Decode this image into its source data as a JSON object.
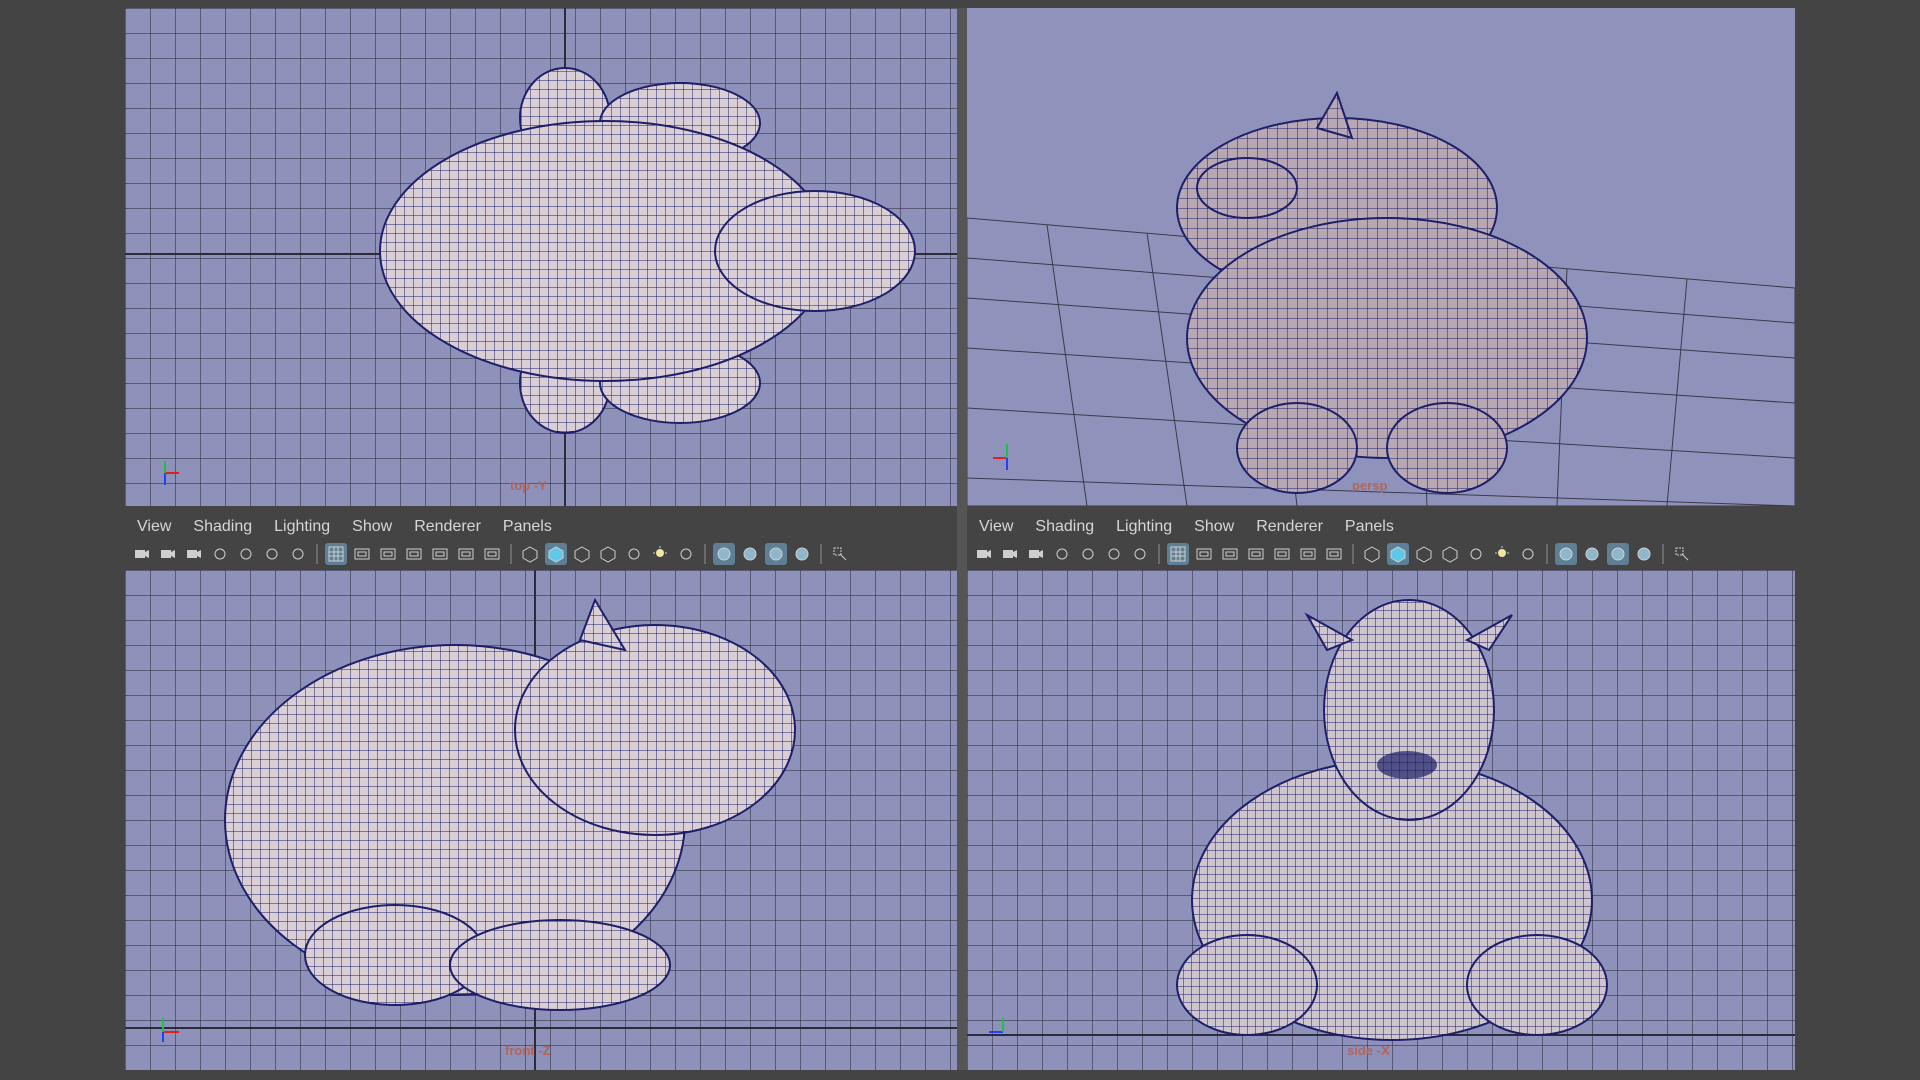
{
  "menus": [
    "View",
    "Shading",
    "Lighting",
    "Show",
    "Renderer",
    "Panels"
  ],
  "viewports": {
    "top": {
      "label": "top -Y"
    },
    "persp": {
      "label": "persp"
    },
    "front": {
      "label": "front -Z"
    },
    "side": {
      "label": "side -X"
    }
  },
  "toolbar_icons": [
    "camera-icon",
    "camera-lock-icon",
    "camera-attr-icon",
    "bookmark-icon",
    "image-plane-icon",
    "pan-zoom-icon",
    "grease-pencil-icon",
    "sep",
    "grid-icon",
    "film-gate-icon",
    "resolution-gate-icon",
    "gate-mask-icon",
    "field-chart-icon",
    "safe-action-icon",
    "safe-title-icon",
    "sep",
    "wireframe-icon",
    "smooth-shade-icon",
    "default-material-icon",
    "wireframe-on-shaded-icon",
    "xray-icon",
    "use-lights-icon",
    "shadows-icon",
    "sep",
    "ambient-occlusion-icon",
    "motion-blur-icon",
    "antialiasing-icon",
    "depth-of-field-icon",
    "sep",
    "isolate-select-icon"
  ],
  "active_icons": [
    "grid-icon",
    "smooth-shade-icon",
    "ambient-occlusion-icon",
    "antialiasing-icon"
  ],
  "colors": {
    "viewport_bg": "#8e91ba",
    "mesh_fill": "#d9cfd4",
    "wire": "#1d1f6a",
    "chrome": "#444444",
    "label": "#b0665a"
  }
}
